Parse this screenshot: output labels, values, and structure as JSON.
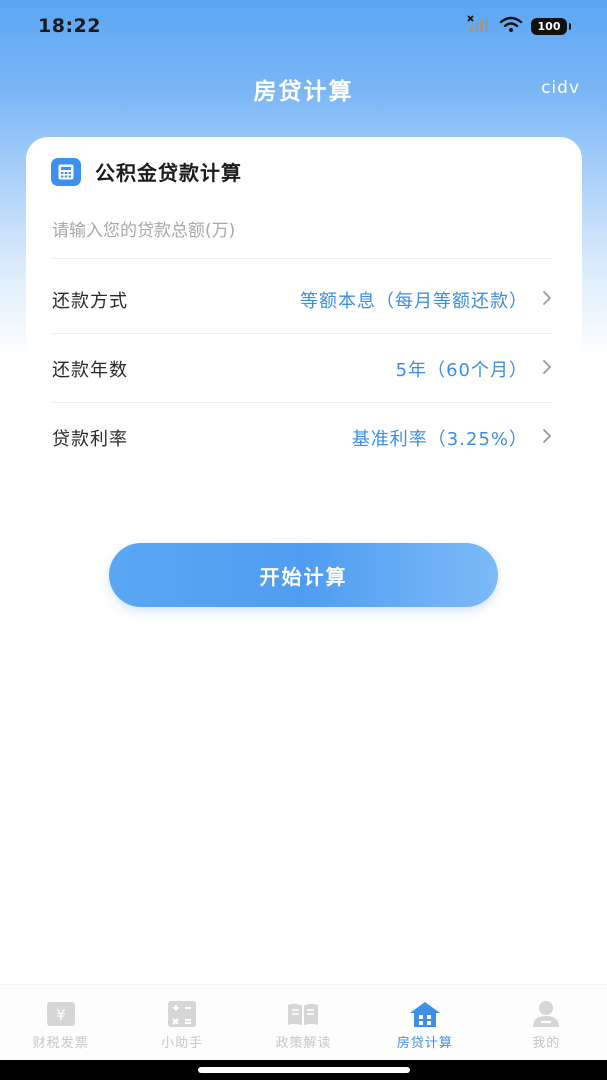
{
  "status_bar": {
    "time": "18:22",
    "battery": "100",
    "icons": [
      "signal-icon",
      "wifi-icon",
      "battery-icon"
    ]
  },
  "header": {
    "title": "房贷计算",
    "right_text": "cidv"
  },
  "card": {
    "title": "公积金贷款计算",
    "icon": "calculator-icon",
    "amount_input": {
      "placeholder": "请输入您的贷款总额(万)",
      "value": ""
    },
    "rows": [
      {
        "label": "还款方式",
        "value": "等额本息（每月等额还款）"
      },
      {
        "label": "还款年数",
        "value": "5年（60个月）"
      },
      {
        "label": "贷款利率",
        "value": "基准利率（3.25%）"
      }
    ]
  },
  "start_button": {
    "label": "开始计算"
  },
  "tab_bar": {
    "tabs": [
      {
        "label": "财税发票",
        "icon": "invoice-icon",
        "active": false
      },
      {
        "label": "小助手",
        "icon": "calculator-icon",
        "active": false
      },
      {
        "label": "政策解读",
        "icon": "book-icon",
        "active": false
      },
      {
        "label": "房贷计算",
        "icon": "house-icon",
        "active": true
      },
      {
        "label": "我的",
        "icon": "user-icon",
        "active": false
      }
    ]
  },
  "colors": {
    "accent": "#3b8de6",
    "header_gradient_top": "#5aa6f4",
    "button": "#4e9df2",
    "inactive_tab": "#c6c6c6"
  }
}
